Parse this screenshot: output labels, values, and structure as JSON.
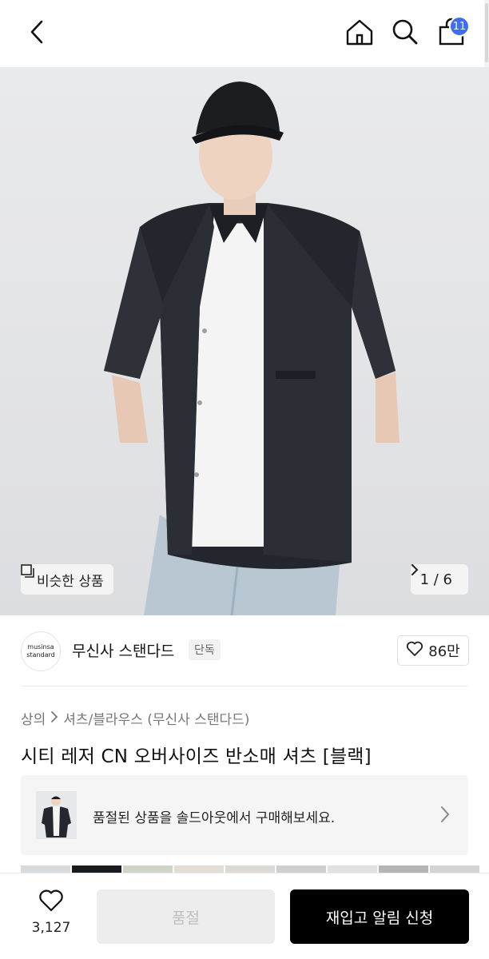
{
  "header": {
    "cart_count": "11",
    "icons": [
      "back-icon",
      "home-icon",
      "search-icon",
      "bag-icon"
    ]
  },
  "gallery": {
    "similar_label": "비슷한 상품",
    "page_indicator": "1 / 6"
  },
  "brand": {
    "logo_line1": "musinsa",
    "logo_line2": "standard",
    "name": "무신사 스탠다드",
    "tag": "단독",
    "likes": "86만"
  },
  "breadcrumb": {
    "level1": "상의",
    "level2": "셔츠/블라우스 (무신사 스탠다드)"
  },
  "product": {
    "title": "시티 레저 CN 오버사이즈 반소매 셔츠 [블랙]"
  },
  "soldout_banner": {
    "text": "품절된 상품을 솔드아웃에서 구매해보세요."
  },
  "bottom_bar": {
    "wish_count": "3,127",
    "soldout_label": "품절",
    "restock_label": "재입고 알림 신청"
  },
  "colors": {
    "badge": "#3f6ff0",
    "primary_button": "#000000",
    "disabled_button": "#ededed"
  }
}
